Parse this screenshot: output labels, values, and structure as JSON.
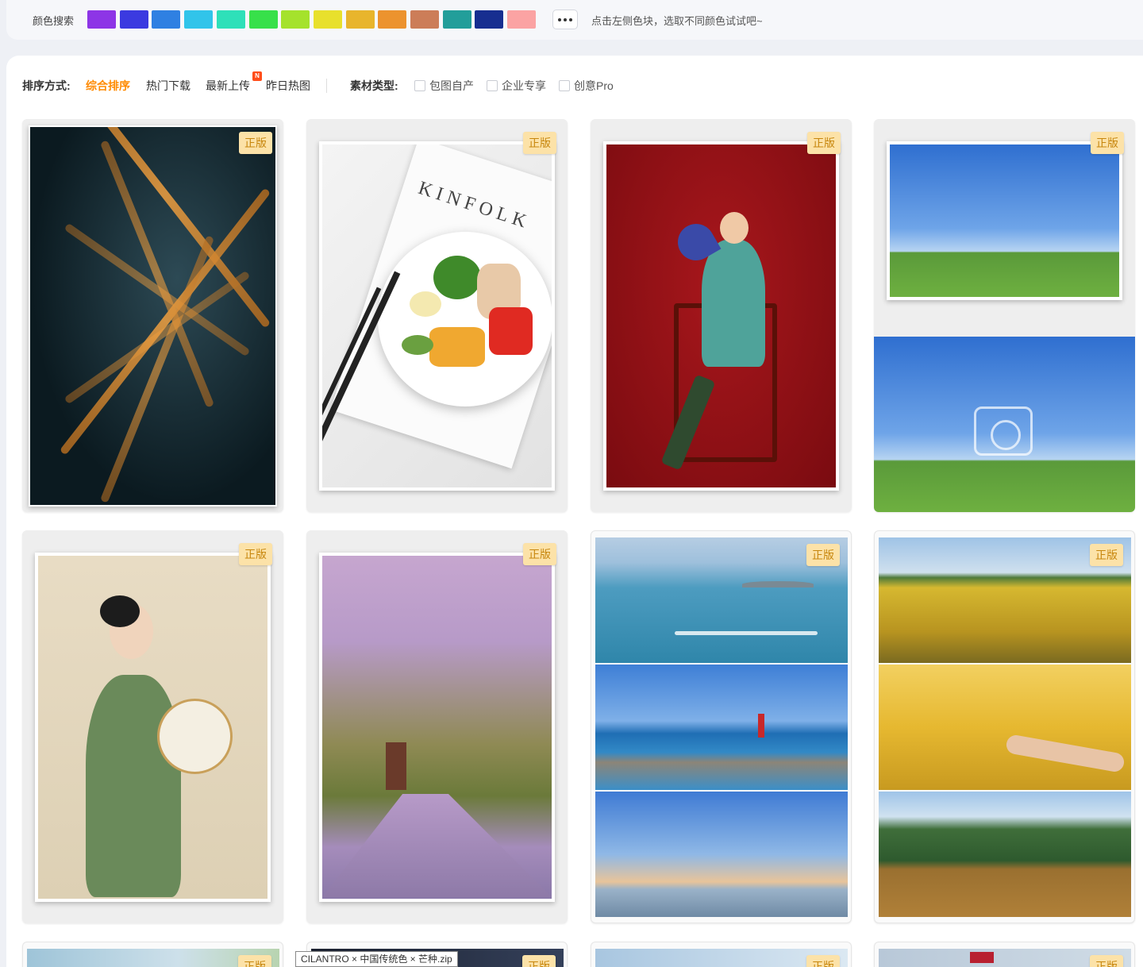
{
  "color_search": {
    "label": "颜色搜索",
    "swatches": [
      {
        "name": "purple",
        "hex": "#8d35e6"
      },
      {
        "name": "indigo",
        "hex": "#3b3ae0"
      },
      {
        "name": "blue",
        "hex": "#2f80e2"
      },
      {
        "name": "sky",
        "hex": "#31c4ea"
      },
      {
        "name": "turquoise",
        "hex": "#2ee0b9"
      },
      {
        "name": "green",
        "hex": "#37e04a"
      },
      {
        "name": "lime",
        "hex": "#a5e22c"
      },
      {
        "name": "yellow",
        "hex": "#e8e02c"
      },
      {
        "name": "gold",
        "hex": "#e8b52c"
      },
      {
        "name": "orange",
        "hex": "#ec932e"
      },
      {
        "name": "brown",
        "hex": "#cc7d58"
      },
      {
        "name": "teal",
        "hex": "#229e9a"
      },
      {
        "name": "navy",
        "hex": "#172e90"
      },
      {
        "name": "pink",
        "hex": "#fba3a3"
      }
    ],
    "more_icon": "more-dots-icon",
    "hint": "点击左侧色块，选取不同颜色试试吧~"
  },
  "filter": {
    "sort_label": "排序方式:",
    "sort_options": [
      "综合排序",
      "热门下载",
      "最新上传",
      "昨日热图"
    ],
    "active_sort": "综合排序",
    "new_badge": "N",
    "type_label": "素材类型:",
    "types": [
      "包图自产",
      "企业专享",
      "创意Pro"
    ]
  },
  "colors": {
    "accent": "#ff8a00",
    "tag_bg": "#fce2a8",
    "tag_text": "#c7860d"
  },
  "cards": {
    "tag_label": "正版",
    "items": [
      {
        "name": "highway-interchange-night"
      },
      {
        "name": "kinfolk-magazine-salad-plate",
        "magazine_text": "KINFOLK"
      },
      {
        "name": "woman-cheongsam-red-chair"
      },
      {
        "name": "blue-sky-grassland"
      },
      {
        "name": "woman-cheongsam-fan"
      },
      {
        "name": "cherry-blossom-road"
      },
      {
        "name": "sea-jetski-lighthouse-dusk"
      },
      {
        "name": "rice-wheat-field-hills"
      }
    ]
  },
  "bottom_tooltip": {
    "text": "CILANTRO × 中国传统色 × 芒种.zip"
  }
}
